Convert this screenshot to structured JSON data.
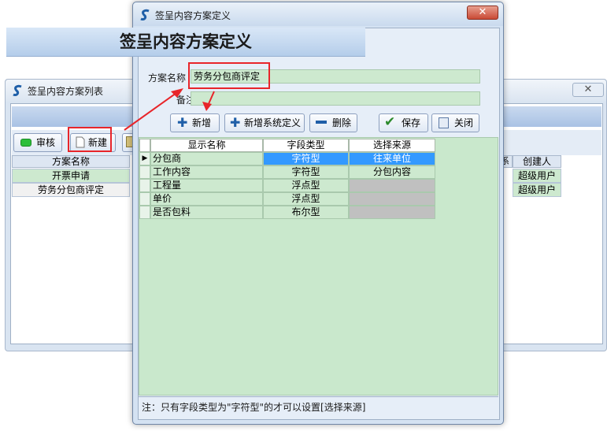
{
  "background_window": {
    "title": "签呈内容方案列表",
    "close_label": "✕",
    "toolbar": {
      "review_label": "审核",
      "new_label": "新建"
    },
    "grid": {
      "columns": [
        "方案名称",
        "创建人"
      ],
      "rows": [
        {
          "name": "开票申请",
          "creator": "超级用户"
        },
        {
          "name": "劳务分包商评定",
          "creator": "超级用户"
        }
      ]
    }
  },
  "dialog": {
    "title": "签呈内容方案定义",
    "close_label": "✕",
    "header": "签呈内容方案定义",
    "scheme_name_label": "方案名称",
    "scheme_name_value": "劳务分包商评定",
    "remark_label": "备注",
    "remark_value": "",
    "toolbar": {
      "add_label": "新增",
      "add_system_label": "新增系统定义",
      "delete_label": "删除",
      "save_label": "保存",
      "close_label": "关闭"
    },
    "grid": {
      "columns": [
        "显示名称",
        "字段类型",
        "选择来源"
      ],
      "rows": [
        {
          "name": "分包商",
          "type": "字符型",
          "source": "往来单位"
        },
        {
          "name": "工作内容",
          "type": "字符型",
          "source": "分包内容"
        },
        {
          "name": "工程量",
          "type": "浮点型",
          "source": ""
        },
        {
          "name": "单价",
          "type": "浮点型",
          "source": ""
        },
        {
          "name": "是否包料",
          "type": "布尔型",
          "source": ""
        }
      ],
      "selected_row_indicator": "▶"
    },
    "note": "注：只有字段类型为\"字符型\"的才可以设置[选择来源]"
  },
  "colors": {
    "grid_green": "#cde9cf",
    "selection_blue": "#3399ff",
    "highlight_red": "#e8252a"
  }
}
